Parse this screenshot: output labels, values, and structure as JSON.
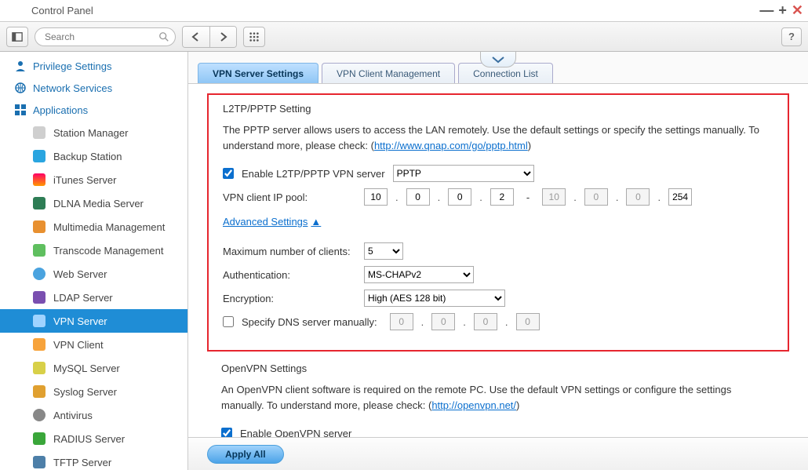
{
  "window": {
    "title": "Control Panel"
  },
  "toolbar": {
    "search_placeholder": "Search"
  },
  "sidebar": {
    "groups": {
      "priv": "Privilege Settings",
      "net": "Network Services",
      "apps": "Applications"
    },
    "items": [
      "Station Manager",
      "Backup Station",
      "iTunes Server",
      "DLNA Media Server",
      "Multimedia Management",
      "Transcode Management",
      "Web Server",
      "LDAP Server",
      "VPN Server",
      "VPN Client",
      "MySQL Server",
      "Syslog Server",
      "Antivirus",
      "RADIUS Server",
      "TFTP Server"
    ]
  },
  "tabs": {
    "t0": "VPN Server Settings",
    "t1": "VPN Client Management",
    "t2": "Connection List"
  },
  "l2tp": {
    "title": "L2TP/PPTP Setting",
    "desc_pre": "The PPTP server allows users to access the LAN remotely. Use the default settings or specify the settings manually. To understand more, please check: (",
    "link": "http://www.qnap.com/go/pptp.html",
    "desc_post": ")",
    "enable_label": "Enable L2TP/PPTP VPN server",
    "protocol": "PPTP",
    "pool_label": "VPN client IP pool:",
    "pool": {
      "a": "10",
      "b": "0",
      "c": "0",
      "d1": "2",
      "e": "10",
      "f": "0",
      "g": "0",
      "d2": "254"
    },
    "adv_label": "Advanced Settings",
    "max_label": "Maximum number of clients:",
    "max_val": "5",
    "auth_label": "Authentication:",
    "auth_val": "MS-CHAPv2",
    "enc_label": "Encryption:",
    "enc_val": "High (AES 128 bit)",
    "dns_label": "Specify DNS server manually:",
    "dns": {
      "a": "0",
      "b": "0",
      "c": "0",
      "d": "0"
    }
  },
  "openvpn": {
    "title": "OpenVPN Settings",
    "desc_pre": "An OpenVPN client software is required on the remote PC. Use the default VPN settings or configure the settings manually. To understand more, please check: (",
    "link": "http://openvpn.net/",
    "desc_post": ")",
    "enable_label": "Enable OpenVPN server"
  },
  "footer": {
    "apply": "Apply All"
  }
}
